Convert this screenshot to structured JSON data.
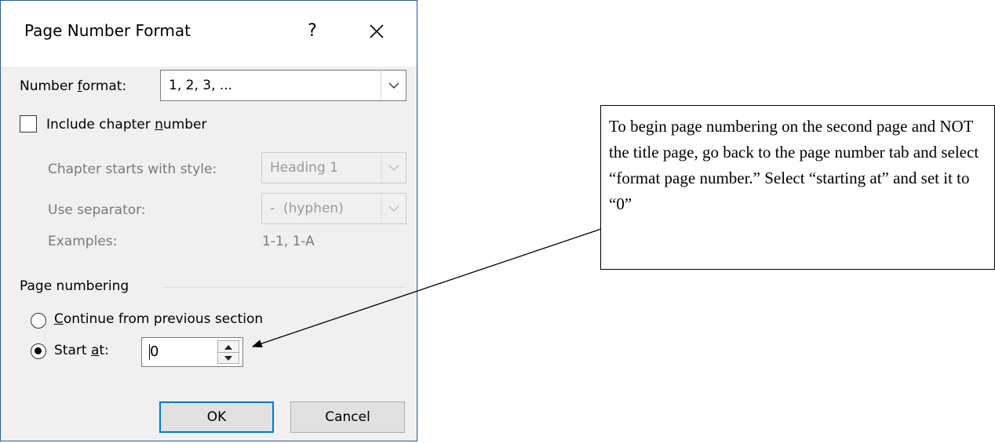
{
  "dialog": {
    "title": "Page Number Format",
    "help_glyph": "?",
    "close_icon": "close-icon"
  },
  "number_format": {
    "label_pre": "Number ",
    "label_accel": "f",
    "label_post": "ormat:",
    "value": "1, 2, 3, ..."
  },
  "include_chapter": {
    "label_pre": "Include chapter ",
    "label_accel": "n",
    "label_post": "umber",
    "checked": false
  },
  "chapter_starts": {
    "label": "Chapter starts with style:",
    "value": "Heading 1"
  },
  "separator": {
    "label": "Use separator:",
    "value": "-  (hyphen)"
  },
  "examples": {
    "label": "Examples:",
    "value": "1-1, 1-A"
  },
  "page_numbering": {
    "section_label": "Page numbering",
    "continue_pre": "",
    "continue_accel": "C",
    "continue_post": "ontinue from previous section",
    "start_pre": "Start ",
    "start_accel": "a",
    "start_post": "t:",
    "start_value": "0",
    "selected": "start_at"
  },
  "buttons": {
    "ok": "OK",
    "cancel": "Cancel"
  },
  "callout": {
    "text": "To begin page numbering on the second page and NOT the title page, go back to the page number tab and select “format page number.” Select “starting at” and set it to “0”"
  }
}
